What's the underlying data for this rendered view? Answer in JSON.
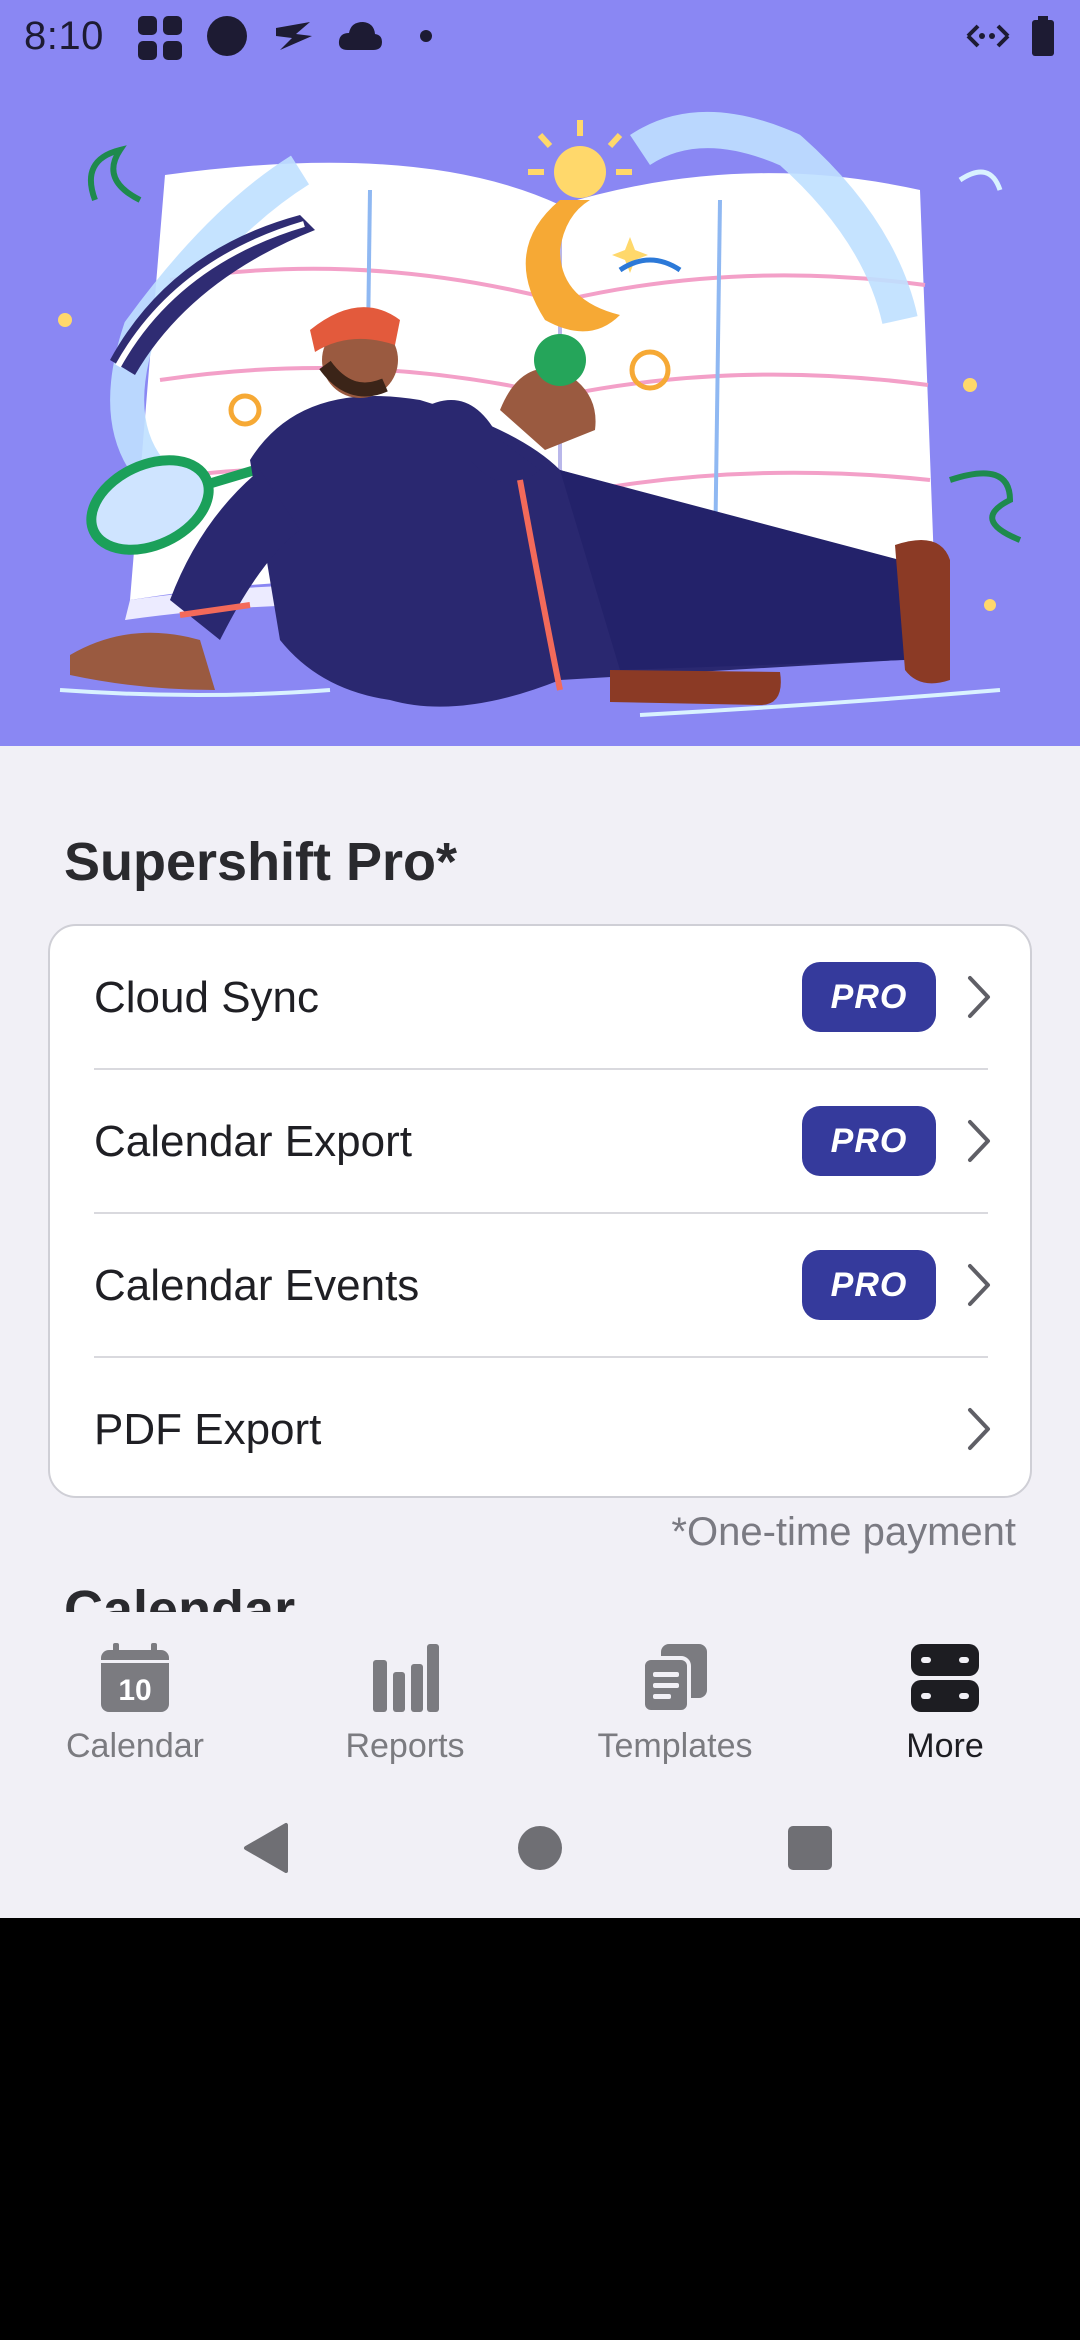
{
  "status_bar": {
    "time": "8:10"
  },
  "hero": {
    "illustration": "person-leaning-on-calendar-illustration"
  },
  "section": {
    "title": "Supershift Pro*",
    "items": [
      {
        "label": "Cloud Sync",
        "badge": "PRO"
      },
      {
        "label": "Calendar Export",
        "badge": "PRO"
      },
      {
        "label": "Calendar Events",
        "badge": "PRO"
      },
      {
        "label": "PDF Export",
        "badge": ""
      }
    ],
    "footnote": "*One-time payment"
  },
  "next_section": {
    "title": "Calendar"
  },
  "bottom_nav": {
    "items": [
      {
        "label": "Calendar",
        "icon": "calendar-icon",
        "icon_text": "10"
      },
      {
        "label": "Reports",
        "icon": "bar-chart-icon"
      },
      {
        "label": "Templates",
        "icon": "templates-icon"
      },
      {
        "label": "More",
        "icon": "more-icon"
      }
    ],
    "active": "More"
  },
  "colors": {
    "hero_background": "#8a87f3",
    "pro_badge": "#353a9c",
    "page_background": "#f1f0f6"
  }
}
